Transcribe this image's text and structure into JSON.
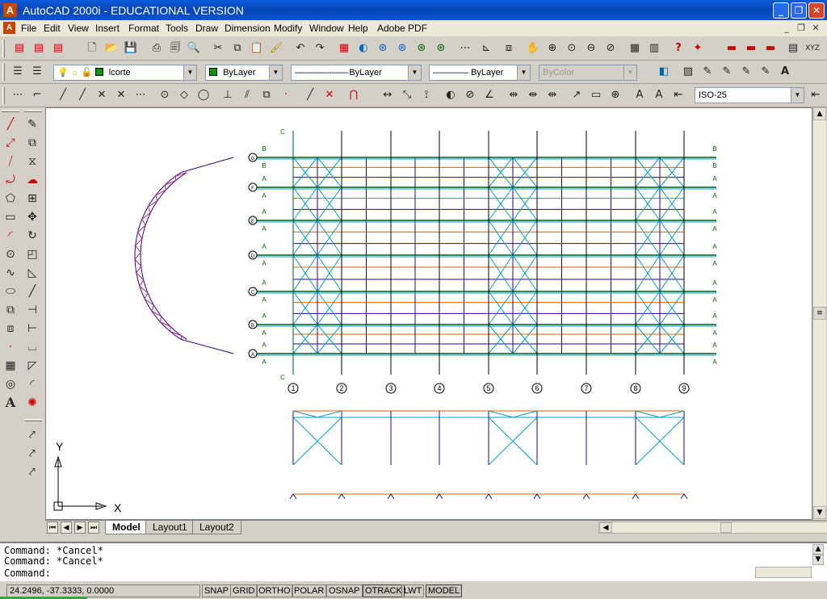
{
  "window": {
    "title": "AutoCAD 2000i - EDUCATIONAL VERSION",
    "minimize": "_",
    "restore": "❐",
    "close": "✕"
  },
  "menu": [
    "File",
    "Edit",
    "View",
    "Insert",
    "Format",
    "Tools",
    "Draw",
    "Dimension",
    "Modify",
    "Window",
    "Help",
    "Adobe PDF"
  ],
  "layers": {
    "current_layer": "lcorte",
    "color": "ByLayer",
    "linetype": "ByLayer",
    "lineweight": "ByLayer",
    "plotstyle": "ByColor"
  },
  "dimstyle": "ISO-25",
  "drawing": {
    "column_labels": [
      "1",
      "2",
      "3",
      "4",
      "5",
      "6",
      "7",
      "8",
      "9"
    ],
    "row_labels": [
      "G",
      "F",
      "E",
      "D",
      "C",
      "B",
      "A"
    ],
    "section_marks": {
      "b": "B",
      "a": "A",
      "c": "C"
    },
    "ucs": {
      "x_label": "X",
      "y_label": "Y"
    },
    "colors": {
      "grid": "#005a1e",
      "brace": "#00a0d0",
      "purlin": "#e06000",
      "beam": "#300090"
    }
  },
  "tabs": [
    "Model",
    "Layout1",
    "Layout2"
  ],
  "active_tab": "Model",
  "command_history": [
    "Command: *Cancel*",
    "Command: *Cancel*"
  ],
  "command_prompt": "Command:",
  "status": {
    "coordinates": "24.2496, -37.3333, 0.0000",
    "toggles": [
      "SNAP",
      "GRID",
      "ORTHO",
      "POLAR",
      "OSNAP",
      "OTRACK",
      "LWT",
      "MODEL"
    ]
  }
}
